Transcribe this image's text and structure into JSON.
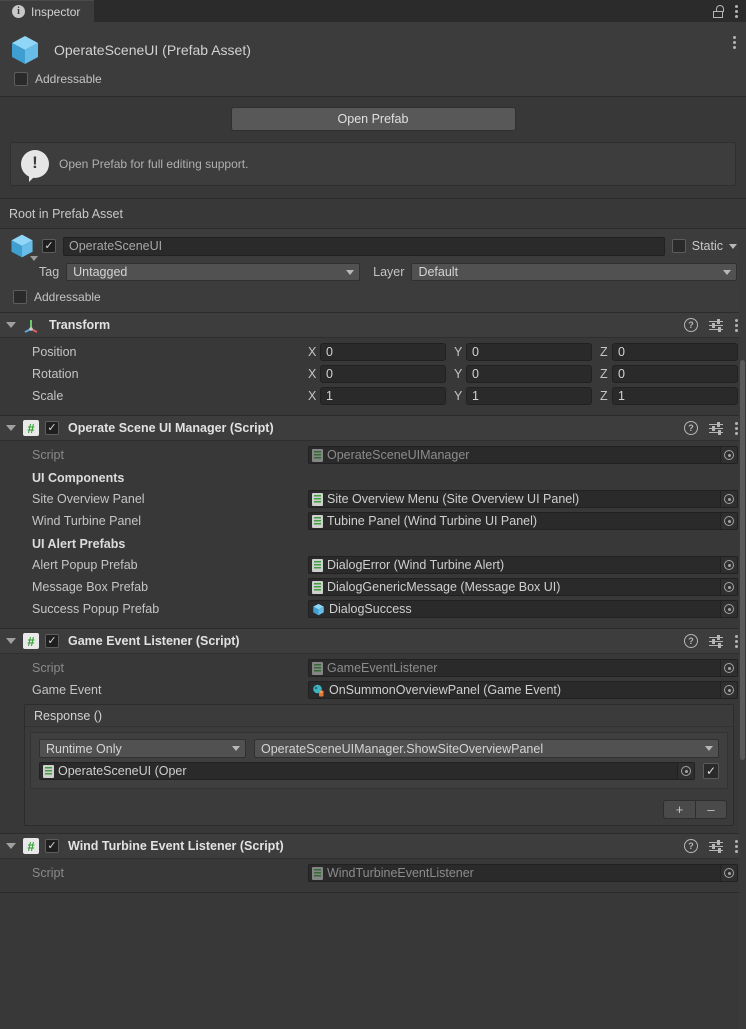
{
  "window": {
    "tab_label": "Inspector",
    "tab_icon": "info-icon",
    "lock_icon": "lock-open-icon",
    "menu_icon": "kebab-menu-icon"
  },
  "asset": {
    "title": "OperateSceneUI (Prefab Asset)",
    "icon": "prefab-cube-icon",
    "addressable_label": "Addressable",
    "addressable_checked": false
  },
  "prefab_actions": {
    "open_prefab_label": "Open Prefab",
    "helpbox_text": "Open Prefab for full editing support.",
    "helpbox_icon": "info-bubble-icon"
  },
  "root_section": {
    "title": "Root in Prefab Asset",
    "enabled_checked": true,
    "object_name": "OperateSceneUI",
    "static_label": "Static",
    "static_checked": false,
    "tag_label": "Tag",
    "tag_value": "Untagged",
    "layer_label": "Layer",
    "layer_value": "Default",
    "addressable_label": "Addressable",
    "addressable_checked": false
  },
  "header_tools": {
    "help_icon": "help-icon",
    "preset_icon": "preset-icon",
    "menu_icon": "kebab-menu-icon"
  },
  "components": [
    {
      "title": "Transform",
      "icon": "transform-axis-icon",
      "has_enable_checkbox": false,
      "rows": [
        {
          "label": "Position",
          "x": "0",
          "y": "0",
          "z": "0"
        },
        {
          "label": "Rotation",
          "x": "0",
          "y": "0",
          "z": "0"
        },
        {
          "label": "Scale",
          "x": "1",
          "y": "1",
          "z": "1"
        }
      ],
      "axis_labels": {
        "x": "X",
        "y": "Y",
        "z": "Z"
      }
    },
    {
      "title": "Operate Scene UI Manager (Script)",
      "icon": "cs-script-icon",
      "enabled_checked": true,
      "script_label": "Script",
      "script_value": "OperateSceneUIManager",
      "groups": [
        {
          "header": "UI Components",
          "fields": [
            {
              "label": "Site Overview Panel",
              "value": "Site Overview Menu (Site Overview UI Panel)",
              "icon": "cs-script-icon"
            },
            {
              "label": "Wind Turbine Panel",
              "value": "Tubine Panel (Wind Turbine UI Panel)",
              "icon": "cs-script-icon"
            }
          ]
        },
        {
          "header": "UI Alert Prefabs",
          "fields": [
            {
              "label": "Alert Popup Prefab",
              "value": "DialogError (Wind Turbine Alert)",
              "icon": "cs-script-icon"
            },
            {
              "label": "Message Box Prefab",
              "value": "DialogGenericMessage (Message Box UI)",
              "icon": "cs-script-icon"
            },
            {
              "label": "Success Popup Prefab",
              "value": "DialogSuccess",
              "icon": "prefab-cube-icon"
            }
          ]
        }
      ]
    },
    {
      "title": "Game Event Listener (Script)",
      "icon": "cs-script-icon",
      "enabled_checked": true,
      "script_label": "Script",
      "script_value": "GameEventListener",
      "game_event_label": "Game Event",
      "game_event_value": "OnSummonOverviewPanel (Game Event)",
      "game_event_icon": "scriptable-object-icon",
      "response": {
        "title": "Response ()",
        "runtime_mode": "Runtime Only",
        "method": "OperateSceneUIManager.ShowSiteOverviewPanel",
        "target_object": "OperateSceneUI (Oper",
        "target_icon": "cs-script-icon",
        "bool_arg_checked": true,
        "add_label": "+",
        "remove_label": "–"
      }
    },
    {
      "title": "Wind Turbine Event Listener (Script)",
      "icon": "cs-script-icon",
      "enabled_checked": true,
      "script_label": "Script",
      "script_value": "WindTurbineEventListener"
    }
  ],
  "colors": {
    "background": "#383838",
    "header": "#3d3d3d",
    "field": "#2a2a2a",
    "accent_cube": "#6dc3ef",
    "accent_script_green": "#3f9e3f"
  }
}
